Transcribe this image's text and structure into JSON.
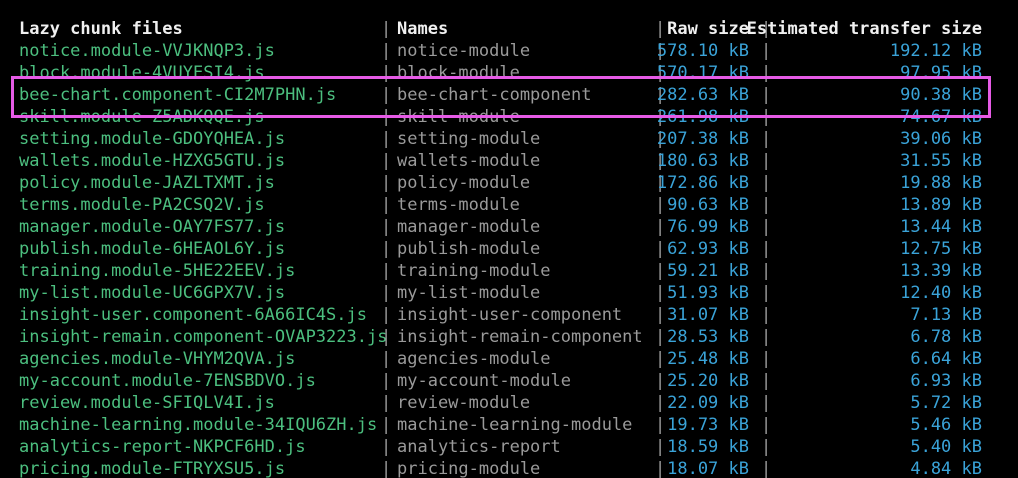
{
  "header": {
    "file": "Lazy chunk files",
    "name": "Names",
    "raw": "Raw size",
    "est": "Estimated transfer size"
  },
  "separator": "|",
  "rows": [
    {
      "file": "notice.module-VVJKNQP3.js",
      "name": "notice-module",
      "raw": "578.10 kB",
      "est": "192.12 kB"
    },
    {
      "file": "block.module-4VUYESI4.js",
      "name": "block-module",
      "raw": "570.17 kB",
      "est": "97.95 kB"
    },
    {
      "file": "bee-chart.component-CI2M7PHN.js",
      "name": "bee-chart-component",
      "raw": "282.63 kB",
      "est": "90.38 kB"
    },
    {
      "file": "skill.module-Z5ADKQQE.js",
      "name": "skill-module",
      "raw": "261.98 kB",
      "est": "74.67 kB"
    },
    {
      "file": "setting.module-GDOYQHEA.js",
      "name": "setting-module",
      "raw": "207.38 kB",
      "est": "39.06 kB"
    },
    {
      "file": "wallets.module-HZXG5GTU.js",
      "name": "wallets-module",
      "raw": "180.63 kB",
      "est": "31.55 kB"
    },
    {
      "file": "policy.module-JAZLTXMT.js",
      "name": "policy-module",
      "raw": "172.86 kB",
      "est": "19.88 kB"
    },
    {
      "file": "terms.module-PA2CSQ2V.js",
      "name": "terms-module",
      "raw": "90.63 kB",
      "est": "13.89 kB"
    },
    {
      "file": "manager.module-OAY7FS77.js",
      "name": "manager-module",
      "raw": "76.99 kB",
      "est": "13.44 kB"
    },
    {
      "file": "publish.module-6HEAOL6Y.js",
      "name": "publish-module",
      "raw": "62.93 kB",
      "est": "12.75 kB"
    },
    {
      "file": "training.module-5HE22EEV.js",
      "name": "training-module",
      "raw": "59.21 kB",
      "est": "13.39 kB"
    },
    {
      "file": "my-list.module-UC6GPX7V.js",
      "name": "my-list-module",
      "raw": "51.93 kB",
      "est": "12.40 kB"
    },
    {
      "file": "insight-user.component-6A66IC4S.js",
      "name": "insight-user-component",
      "raw": "31.07 kB",
      "est": "7.13 kB"
    },
    {
      "file": "insight-remain.component-OVAP3223.js",
      "name": "insight-remain-component",
      "raw": "28.53 kB",
      "est": "6.78 kB"
    },
    {
      "file": "agencies.module-VHYM2QVA.js",
      "name": "agencies-module",
      "raw": "25.48 kB",
      "est": "6.64 kB"
    },
    {
      "file": "my-account.module-7ENSBDVO.js",
      "name": "my-account-module",
      "raw": "25.20 kB",
      "est": "6.93 kB"
    },
    {
      "file": "review.module-SFIQLV4I.js",
      "name": "review-module",
      "raw": "22.09 kB",
      "est": "5.72 kB"
    },
    {
      "file": "machine-learning.module-34IQU6ZH.js",
      "name": "machine-learning-module",
      "raw": "19.73 kB",
      "est": "5.46 kB"
    },
    {
      "file": "analytics-report-NKPCF6HD.js",
      "name": "analytics-report",
      "raw": "18.59 kB",
      "est": "5.40 kB"
    },
    {
      "file": "pricing.module-FTRYXSU5.js",
      "name": "pricing-module",
      "raw": "18.07 kB",
      "est": "4.84 kB"
    }
  ],
  "highlighted_row": "bee-chart.component-CI2M7PHN.js",
  "colors": {
    "background": "#000000",
    "file": "#4cbf7f",
    "name": "#9a9a9a",
    "size": "#3aa3d8",
    "header": "#f0f0f0",
    "highlight": "#e65be6"
  }
}
